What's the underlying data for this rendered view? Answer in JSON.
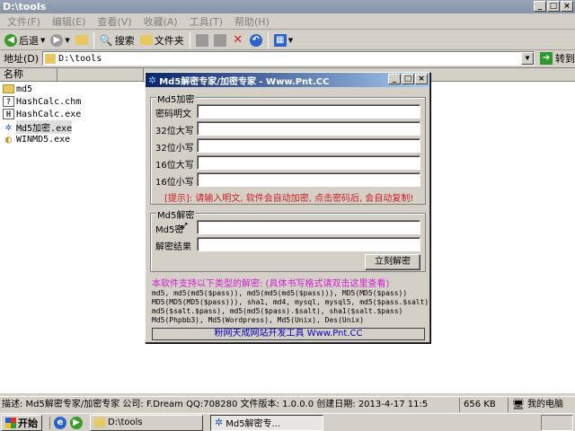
{
  "explorer": {
    "title": "D:\\tools",
    "menu": [
      "文件(F)",
      "编辑(E)",
      "查看(V)",
      "收藏(A)",
      "工具(T)",
      "帮助(H)"
    ],
    "toolbar": {
      "back": "后退",
      "search": "搜索",
      "folders": "文件夹"
    },
    "address_label": "地址(D)",
    "address_value": "D:\\tools",
    "go_label": "转到",
    "column_name": "名称",
    "files": [
      {
        "name": "md5",
        "icon": "folder-icon"
      },
      {
        "name": "HashCalc.chm",
        "icon": "chm-icon"
      },
      {
        "name": "HashCalc.exe",
        "icon": "hashcalc-icon"
      },
      {
        "name": "Md5加密.exe",
        "icon": "gear-icon"
      },
      {
        "name": "WINMD5.exe",
        "icon": "exe-icon"
      }
    ],
    "status": {
      "description": "描述: Md5解密专家/加密专家 公司: F.Dream QQ:708280 文件版本: 1.0.0.0 创建日期: 2013-4-17 11:5",
      "size": "656 KB",
      "location": "我的电脑"
    }
  },
  "dialog": {
    "title": "Md5解密专家/加密专家 - Www.Pnt.CC",
    "encrypt_group": "Md5加密",
    "encrypt_rows": [
      "密码明文",
      "32位大写",
      "32位小写",
      "16位大写",
      "16位小写"
    ],
    "hint": "[提示]: 请输入明文, 软件会自动加密, 点击密码后, 会自动复制!",
    "decrypt_group": "Md5解密",
    "decrypt_cipher_label": "Md5密",
    "decrypt_result_label": "解密结果",
    "decrypt_button": "立刻解密",
    "support_text": "本软件支持以下类型的解密: (具体书写格式请双击这里查看)",
    "formats": [
      "md5, md5(md5($pass)), md5(md5(md5($pass))), MD5(MD5($pass))",
      "MD5(MD5(MD5($pass))), sha1, md4, mysql, mysql5, md5($pass.$salt)",
      "md5($salt.$pass), md5(md5($pass).$salt), sha1($salt.$pass)",
      "Md5(Phpbb3), Md5(Wordpress), Md5(Unix), Des(Unix)"
    ],
    "footer": "粉网天成网站开发工具 Www.Pnt.CC"
  },
  "taskbar": {
    "start": "开始",
    "tasks": [
      "D:\\tools",
      "Md5解密专..."
    ]
  }
}
